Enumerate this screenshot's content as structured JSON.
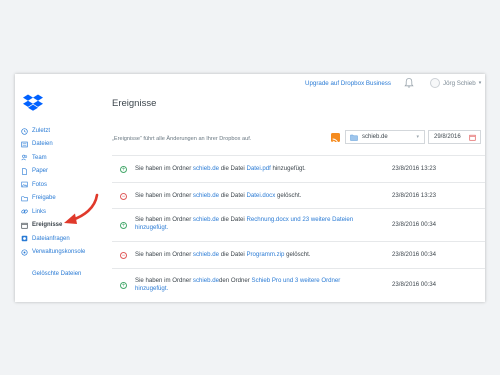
{
  "header": {
    "upgrade_link": "Upgrade auf Dropbox Business",
    "user_name": "Jörg Schieb",
    "user_caret": "▾"
  },
  "page_title": "Ereignisse",
  "sidebar": {
    "items": [
      {
        "label": "Zuletzt",
        "icon": "clock-icon"
      },
      {
        "label": "Dateien",
        "icon": "files-icon"
      },
      {
        "label": "Team",
        "icon": "team-icon"
      },
      {
        "label": "Paper",
        "icon": "paper-icon"
      },
      {
        "label": "Fotos",
        "icon": "photos-icon"
      },
      {
        "label": "Freigabe",
        "icon": "share-icon"
      },
      {
        "label": "Links",
        "icon": "link-icon"
      },
      {
        "label": "Ereignisse",
        "icon": "calendar-icon",
        "active": true
      },
      {
        "label": "Dateianfragen",
        "icon": "file-request-icon"
      },
      {
        "label": "Verwaltungskonsole",
        "icon": "admin-console-icon"
      },
      {
        "label": "Gelöschte Dateien",
        "icon": ""
      }
    ]
  },
  "filters": {
    "description": "„Ereignisse“ führt alle Änderungen an Ihrer Dropbox auf.",
    "folder_value": "schieb.de",
    "folder_caret": "▾",
    "date_value": "29/8/2016"
  },
  "events": [
    {
      "type": "add",
      "parts": [
        {
          "t": "Sie haben im Ordner "
        },
        {
          "t": "schieb.de",
          "link": true
        },
        {
          "t": " die Datei "
        },
        {
          "t": "Datei.pdf",
          "link": true
        },
        {
          "t": " hinzugefügt."
        }
      ],
      "time": "23/8/2016 13:23"
    },
    {
      "type": "delete",
      "parts": [
        {
          "t": "Sie haben im Ordner "
        },
        {
          "t": "schieb.de",
          "link": true
        },
        {
          "t": " die Datei "
        },
        {
          "t": "Datei.docx",
          "link": true
        },
        {
          "t": " gelöscht."
        }
      ],
      "time": "23/8/2016 13:23"
    },
    {
      "type": "add",
      "parts": [
        {
          "t": "Sie haben im Ordner "
        },
        {
          "t": "schieb.de",
          "link": true
        },
        {
          "t": " die Datei "
        },
        {
          "t": "Rechnung.docx und 23 weitere Dateien hinzugefügt.",
          "link": true
        }
      ],
      "time": "23/8/2016 00:34"
    },
    {
      "type": "delete",
      "parts": [
        {
          "t": "Sie haben im Ordner "
        },
        {
          "t": "schieb.de",
          "link": true
        },
        {
          "t": " die Datei "
        },
        {
          "t": "Programm.zip",
          "link": true
        },
        {
          "t": " gelöscht."
        }
      ],
      "time": "23/8/2016 00:34"
    },
    {
      "type": "add",
      "parts": [
        {
          "t": "Sie haben im Ordner "
        },
        {
          "t": "schieb.de",
          "link": true
        },
        {
          "t": "den Ordner "
        },
        {
          "t": "Schieb Pro und 3 weitere Ordner hinzugefügt.",
          "link": true
        }
      ],
      "time": "23/8/2016 00:34"
    }
  ],
  "annotation": {
    "arrow_color": "#e0392b"
  },
  "colors": {
    "accent": "#2a7bd5",
    "dropbox_blue": "#0061ff",
    "add": "#45a86b",
    "delete": "#e05c5c"
  }
}
